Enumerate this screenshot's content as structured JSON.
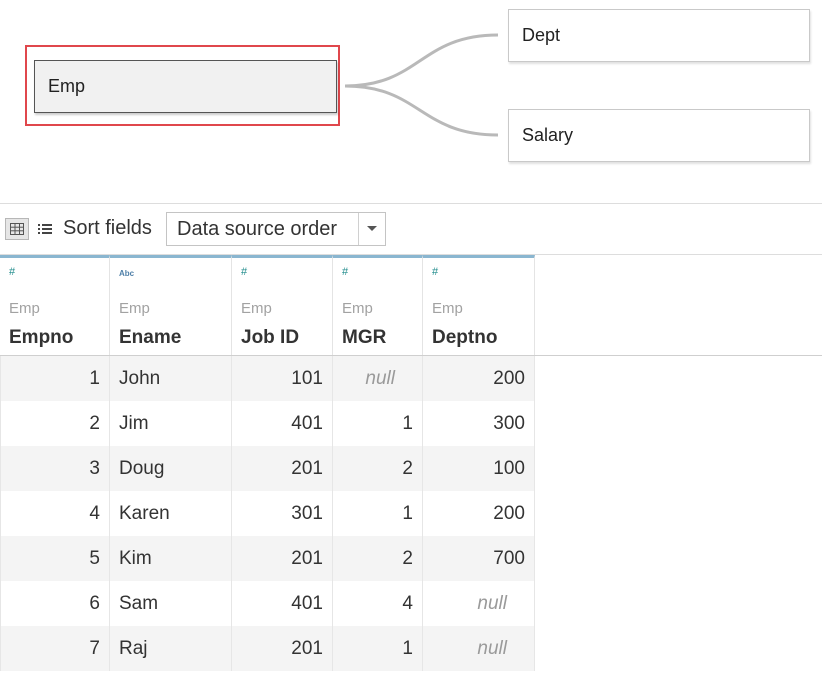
{
  "canvas": {
    "tables": {
      "emp": "Emp",
      "dept": "Dept",
      "salary": "Salary"
    }
  },
  "toolbar": {
    "grid_icon": "grid-view-icon",
    "list_icon": "list-view-icon",
    "sort_label": "Sort fields",
    "sort_value": "Data source order"
  },
  "columns": [
    {
      "type": "#",
      "source": "Emp",
      "name": "Empno"
    },
    {
      "type": "Abc",
      "source": "Emp",
      "name": "Ename"
    },
    {
      "type": "#",
      "source": "Emp",
      "name": "Job ID"
    },
    {
      "type": "#",
      "source": "Emp",
      "name": "MGR"
    },
    {
      "type": "#",
      "source": "Emp",
      "name": "Deptno"
    }
  ],
  "rows": [
    [
      "1",
      "John",
      "101",
      "null",
      "200"
    ],
    [
      "2",
      "Jim",
      "401",
      "1",
      "300"
    ],
    [
      "3",
      "Doug",
      "201",
      "2",
      "100"
    ],
    [
      "4",
      "Karen",
      "301",
      "1",
      "200"
    ],
    [
      "5",
      "Kim",
      "201",
      "2",
      "700"
    ],
    [
      "6",
      "Sam",
      "401",
      "4",
      "null"
    ],
    [
      "7",
      "Raj",
      "201",
      "1",
      "null"
    ]
  ],
  "colors": {
    "selection": "#e0474c",
    "header_accent": "#8ab6d0",
    "numeric_icon": "#1e8b8b",
    "string_icon": "#4e7fa8"
  }
}
